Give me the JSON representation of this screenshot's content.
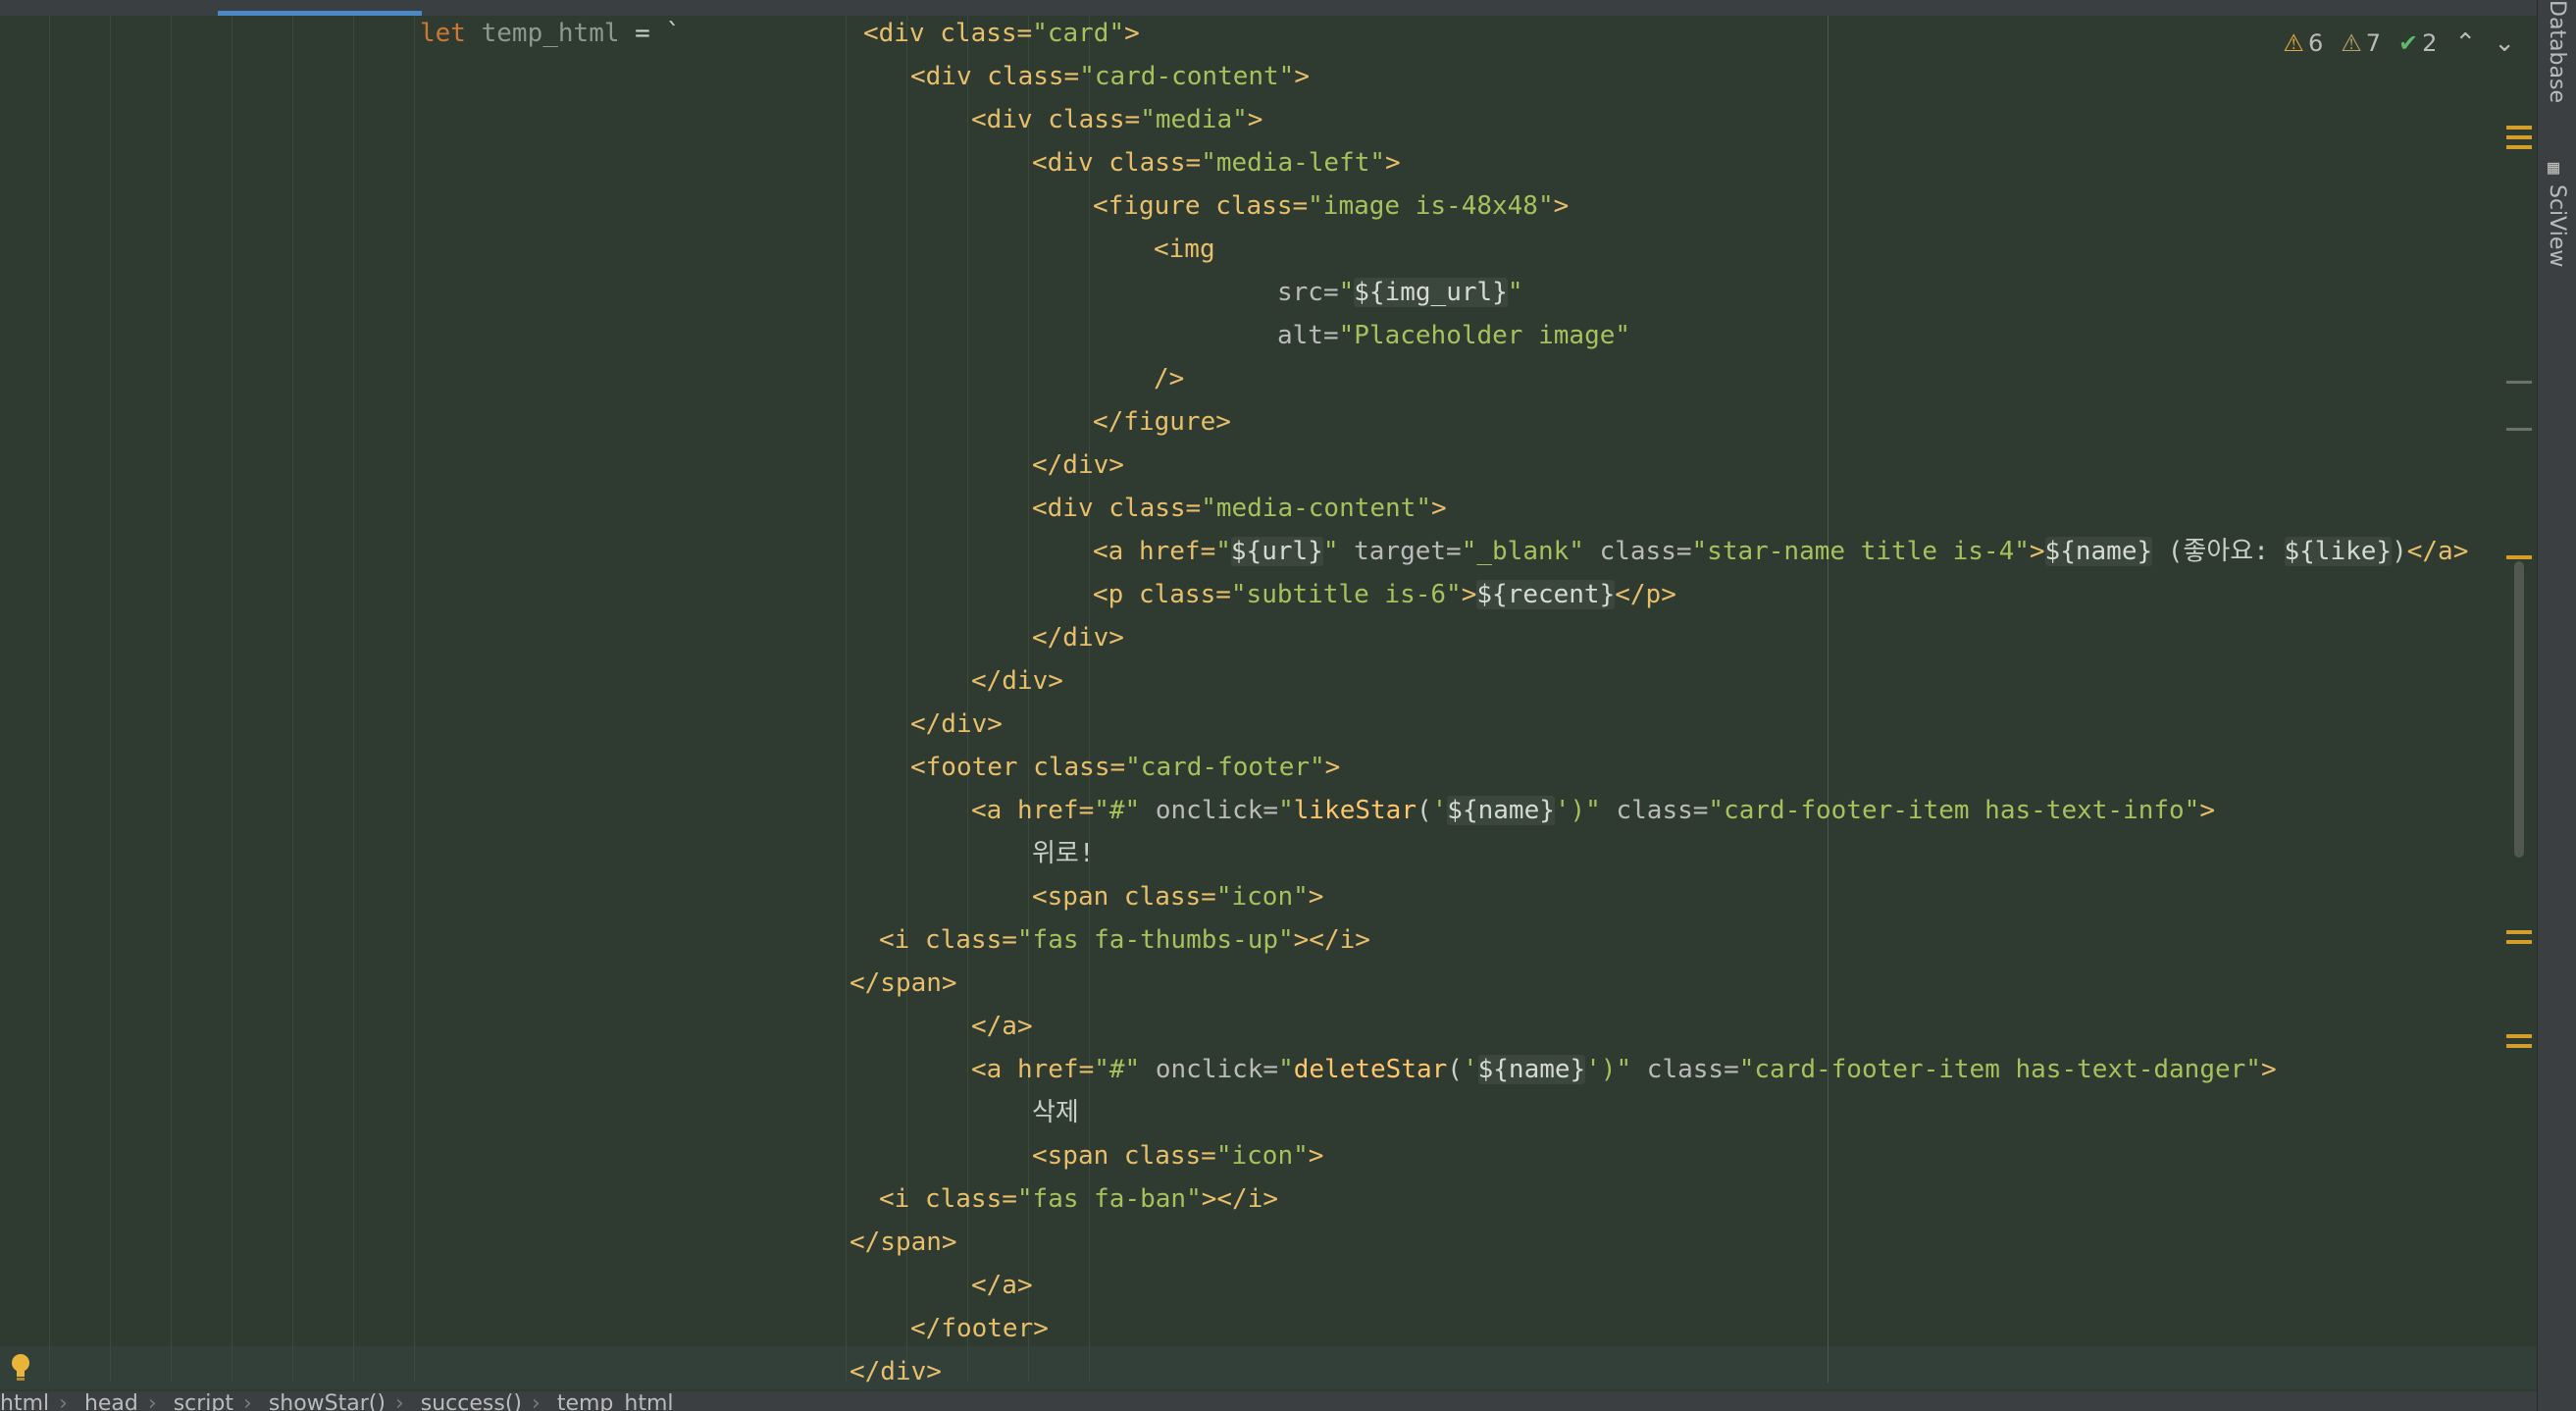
{
  "inspections": {
    "warnings_a": "6",
    "warnings_b": "7",
    "ok": "2"
  },
  "side_panel": {
    "database": "Database",
    "sciview": "SciView"
  },
  "breadcrumbs": [
    "html",
    "head",
    "script",
    "showStar()",
    "success()",
    "temp_html"
  ],
  "code": {
    "l1_kw": "let",
    "l1_var": " temp_html",
    "l1_rest": " = `",
    "div_card_open": "<div class=",
    "div_card_cls": "\"card\"",
    "close_gt": ">",
    "div_content_open": "<div class=",
    "div_content_cls": "\"card-content\"",
    "div_media_cls": "\"media\"",
    "div_media_left_cls": "\"media-left\"",
    "figure_open": "<figure class=",
    "figure_cls": "\"image is-48x48\"",
    "img_open": "<img",
    "src_attr": "src=",
    "q": "\"",
    "img_url": "${img_url}",
    "alt_attr": "alt=",
    "alt_val": "\"Placeholder image\"",
    "self_close": "/>",
    "figure_close": "</figure>",
    "div_close": "</div>",
    "div_media_content_cls": "\"media-content\"",
    "a_href": "<a href=",
    "a_url": "${url}",
    "target_attr": " target=",
    "target_val": "\"_blank\"",
    "class_attr": " class=",
    "star_cls": "\"star-name title is-4\"",
    "name_var": "${name}",
    "like_text": " (좋아요: ",
    "like_var": "${like}",
    "like_close": ")",
    "a_close": "</a>",
    "p_open": "<p class=",
    "p_cls": "\"subtitle is-6\"",
    "recent_var": "${recent}",
    "p_close": "</p>",
    "footer_open": "<footer class=",
    "footer_cls": "\"card-footer\"",
    "hash": "\"#\"",
    "onclick_attr": " onclick=",
    "like_fn": "likeStar",
    "paren_open": "(",
    "sq": "'",
    "paren_close_q": ")\"",
    "like_btn_cls": "\"card-footer-item has-text-info\"",
    "like_label": "위로!",
    "span_open": "<span class=",
    "span_cls": "\"icon\"",
    "i_open": "<i class=",
    "thumbs_cls": "\"fas fa-thumbs-up\"",
    "i_close": "></i>",
    "span_close": "</span>",
    "delete_fn": "deleteStar",
    "del_btn_cls": "\"card-footer-item has-text-danger\"",
    "delete_label": "삭제",
    "ban_cls": "\"fas fa-ban\"",
    "footer_close": "</footer>"
  }
}
